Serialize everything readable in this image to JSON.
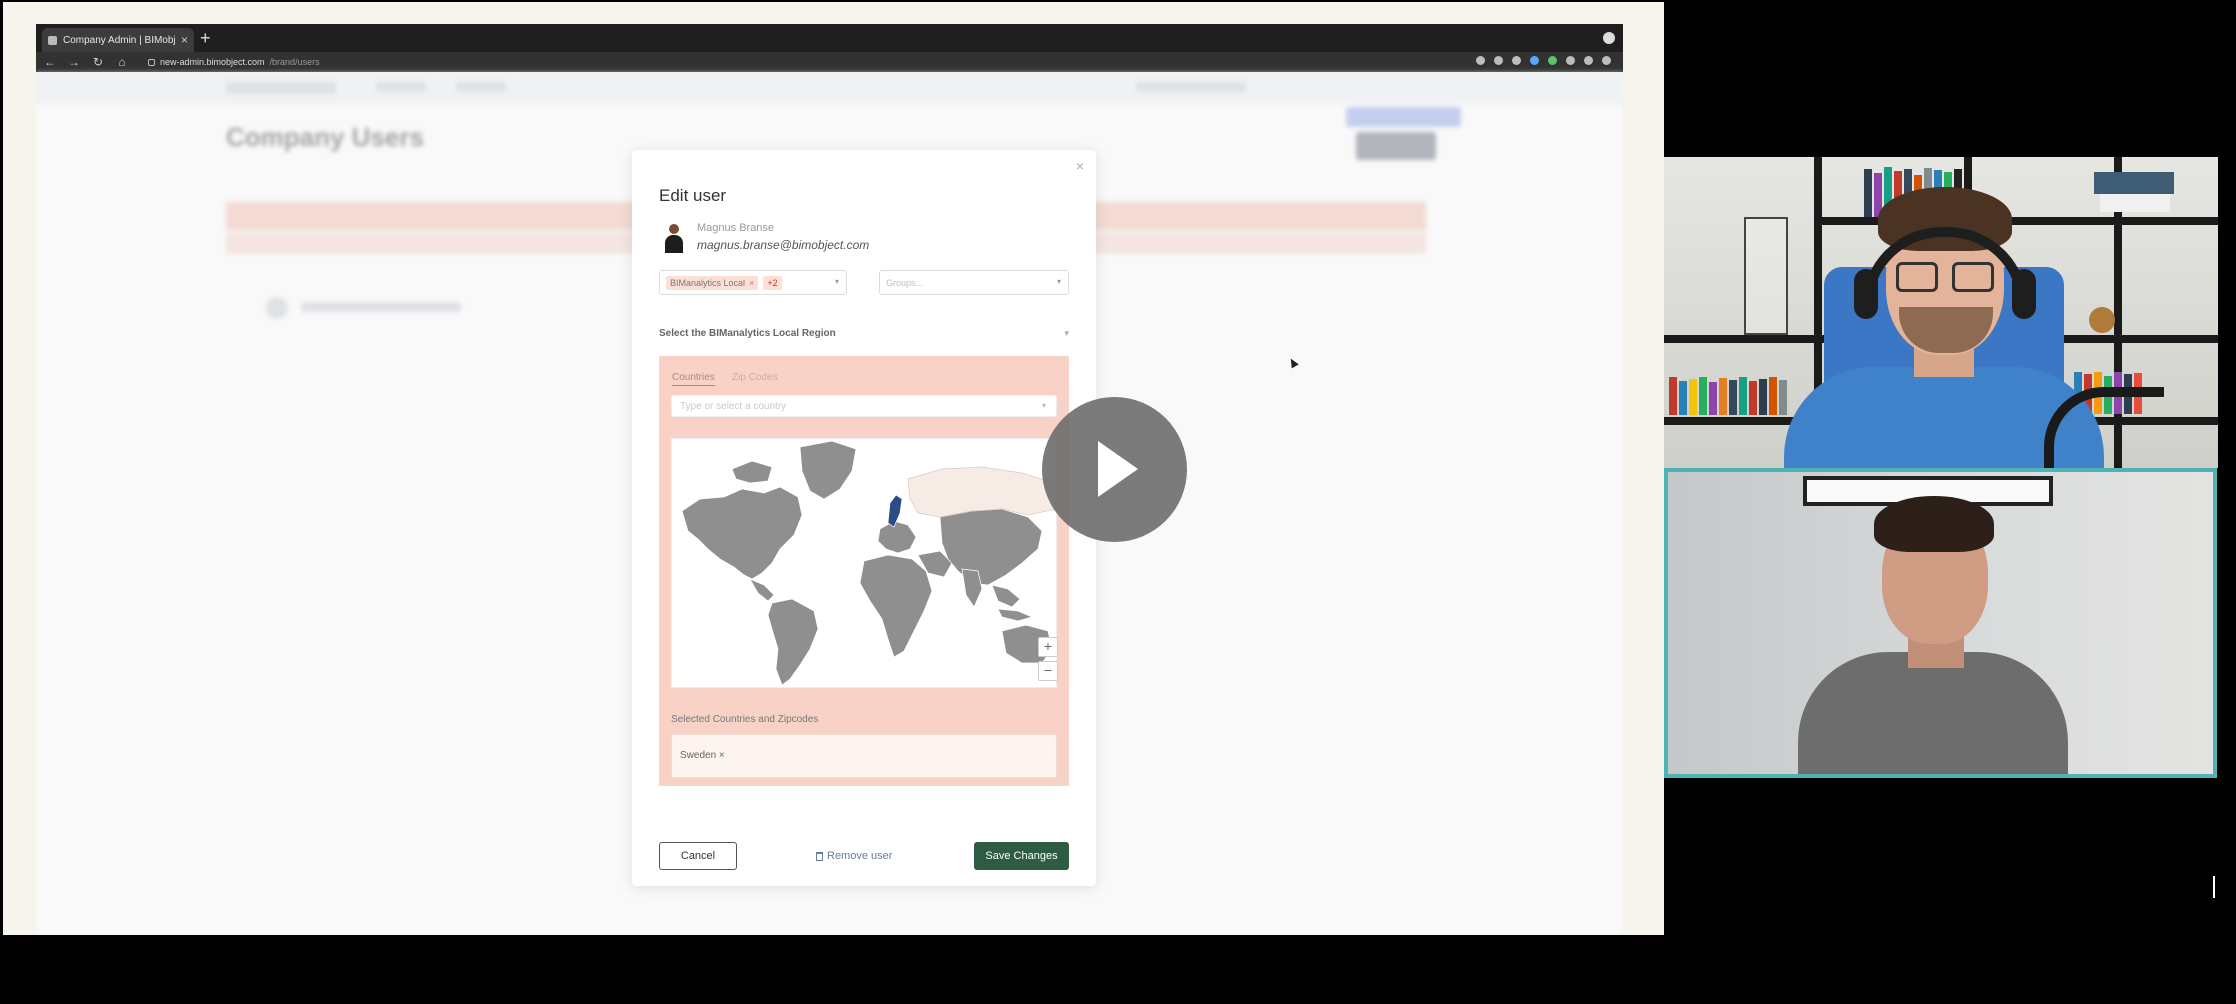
{
  "browser": {
    "tab_title": "Company Admin | BIMobject",
    "url_host": "new-admin.bimobject.com",
    "url_path": "/brand/users"
  },
  "background_page": {
    "heading": "Company Users"
  },
  "modal": {
    "title": "Edit user",
    "close_icon": "×",
    "user": {
      "name": "Magnus Branse",
      "email": "magnus.branse@bimobject.com"
    },
    "role_chip": "BIManalytics Local",
    "role_more": "+2",
    "groups_placeholder": "Groups...",
    "region_label": "Select the BIManalytics Local Region",
    "tabs": [
      "Countries",
      "Zip Codes"
    ],
    "country_placeholder": "Type or select a country",
    "zoom_in": "+",
    "zoom_out": "−",
    "selected_label": "Selected Countries and Zipcodes",
    "selected_chip": "Sweden ×",
    "cancel_label": "Cancel",
    "remove_label": "Remove user",
    "save_label": "Save Changes"
  },
  "colors": {
    "region_panel": "#f8d2c6",
    "save_button": "#2d5b43",
    "map_land": "#8f8f8f",
    "map_highlight": "#2b4a8a",
    "tile_border": "#4fb3b5"
  },
  "icons": {
    "play": "play-icon",
    "trash": "trash-icon",
    "cursor": "mouse-cursor-icon"
  }
}
